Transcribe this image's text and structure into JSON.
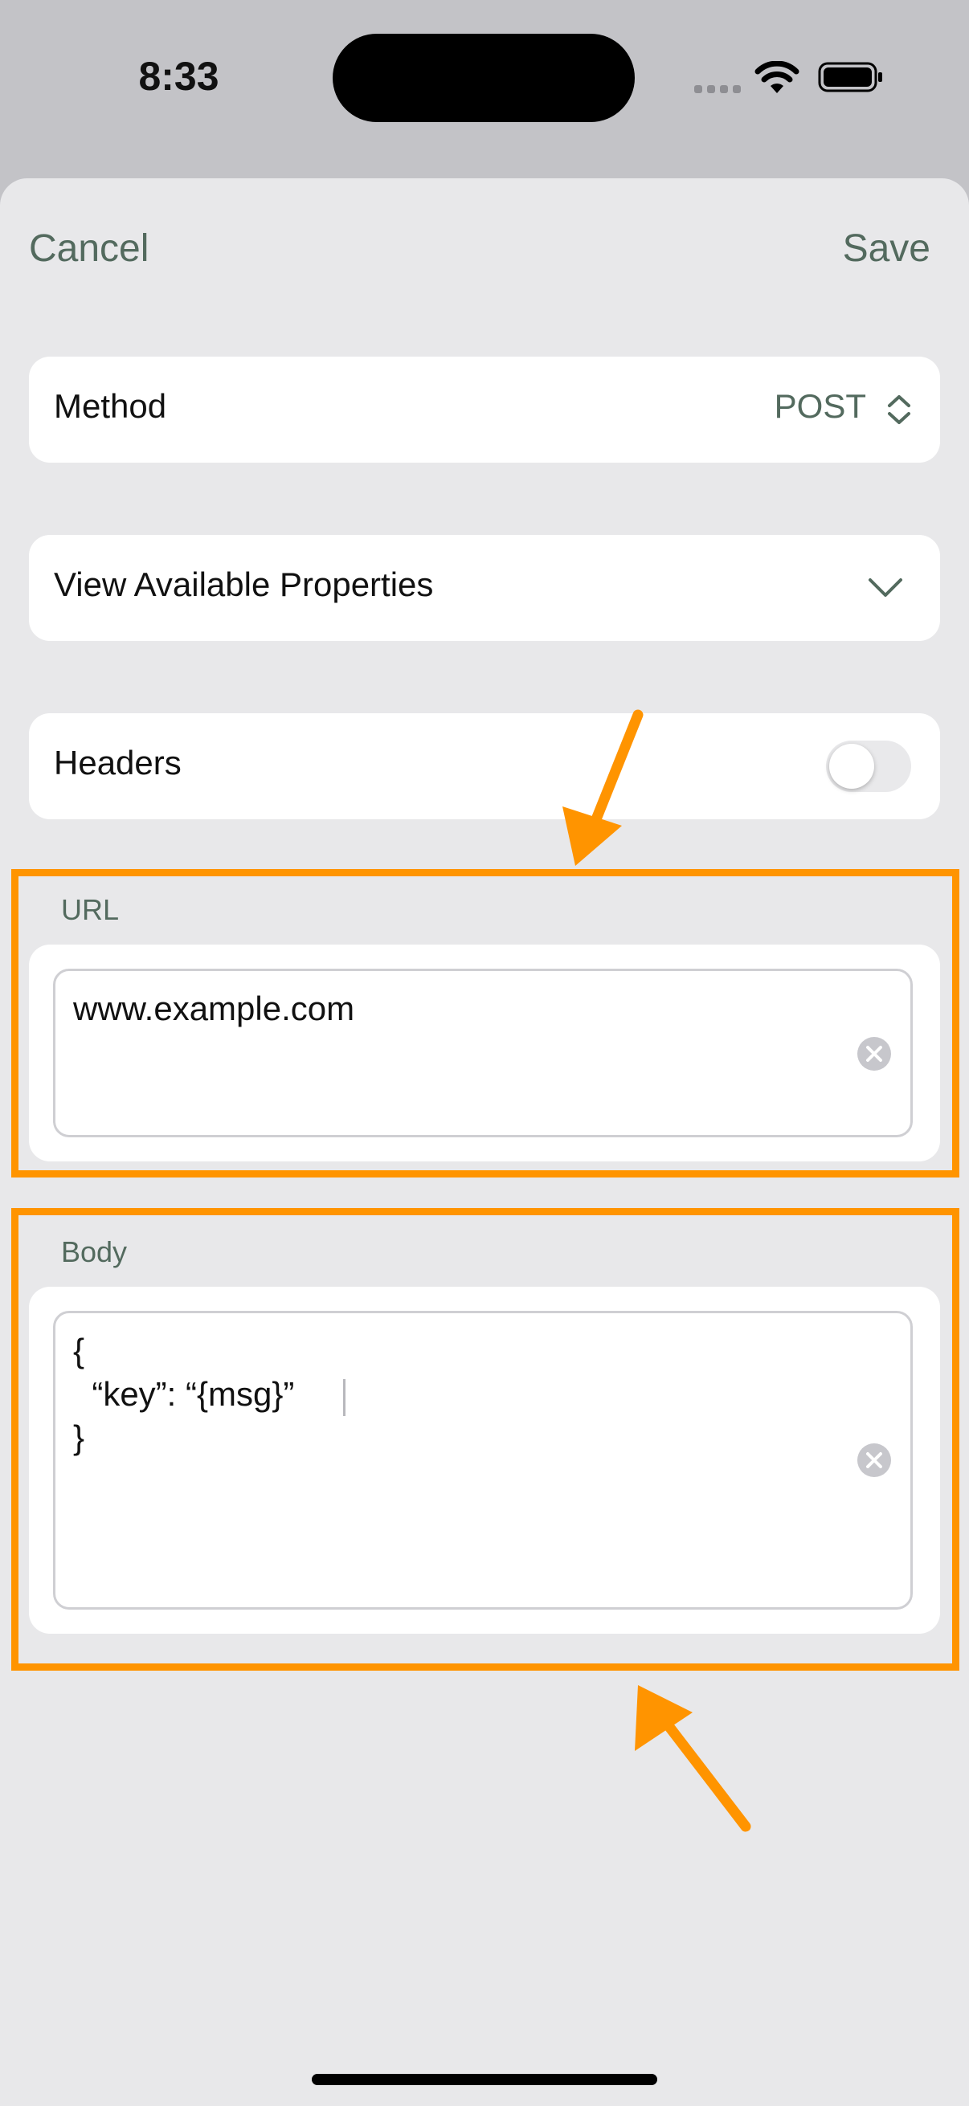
{
  "status_bar": {
    "time": "8:33"
  },
  "nav": {
    "cancel_label": "Cancel",
    "save_label": "Save"
  },
  "method_row": {
    "label": "Method",
    "value": "POST"
  },
  "properties_row": {
    "label": "View Available Properties"
  },
  "headers_row": {
    "label": "Headers",
    "toggle_on": false
  },
  "url_section": {
    "label": "URL",
    "value": "www.example.com"
  },
  "body_section": {
    "label": "Body",
    "value": "{\n  “key”: “{msg}”\n}"
  },
  "colors": {
    "accent_text": "#536a5e",
    "highlight": "#ff9400",
    "sheet_background": "#e8e8ea",
    "card_background": "#ffffff"
  },
  "icons": [
    "signal-icon",
    "wifi-icon",
    "battery-icon",
    "updown-chevron-icon",
    "chevron-down-icon",
    "clear-icon",
    "arrow-icon"
  ]
}
